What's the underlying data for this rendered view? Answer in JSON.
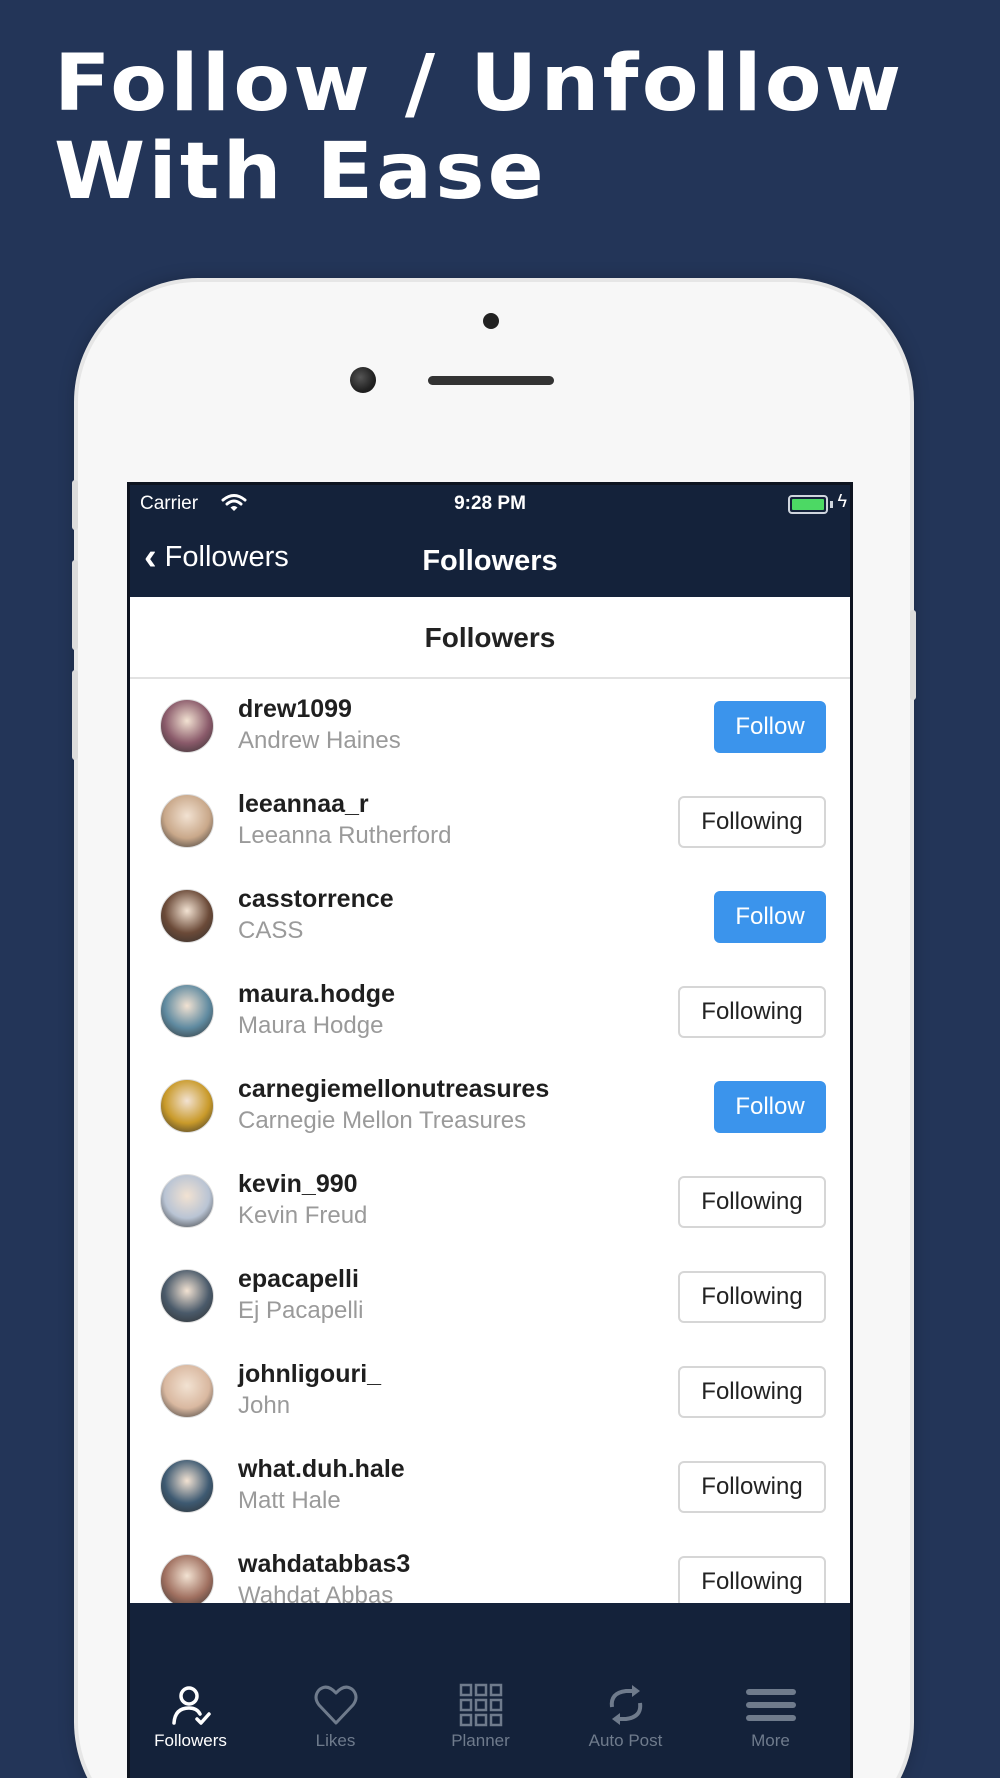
{
  "headline": {
    "line1": "Follow / Unfollow",
    "line2": "With Ease"
  },
  "status_bar": {
    "carrier": "Carrier",
    "time": "9:28 PM"
  },
  "nav": {
    "back_label": "Followers",
    "title": "Followers"
  },
  "section_title": "Followers",
  "followers": [
    {
      "username": "drew1099",
      "name": "Andrew Haines",
      "button": "Follow",
      "state": "follow",
      "avatar_color": "#8a5a6a"
    },
    {
      "username": "leeannaa_r",
      "name": "Leeanna Rutherford",
      "button": "Following",
      "state": "following",
      "avatar_color": "#c9a88a"
    },
    {
      "username": "casstorrence",
      "name": "CASS",
      "button": "Follow",
      "state": "follow",
      "avatar_color": "#6b4a38"
    },
    {
      "username": "maura.hodge",
      "name": "Maura Hodge",
      "button": "Following",
      "state": "following",
      "avatar_color": "#5f8aa0"
    },
    {
      "username": "carnegiemellonutreasures",
      "name": "Carnegie Mellon Treasures",
      "button": "Follow",
      "state": "follow",
      "avatar_color": "#c99a2a"
    },
    {
      "username": "kevin_990",
      "name": "Kevin Freud",
      "button": "Following",
      "state": "following",
      "avatar_color": "#b9c4d4"
    },
    {
      "username": "epacapelli",
      "name": "Ej Pacapelli",
      "button": "Following",
      "state": "following",
      "avatar_color": "#4a5a6a"
    },
    {
      "username": "johnligouri_",
      "name": "John",
      "button": "Following",
      "state": "following",
      "avatar_color": "#d9b8a0"
    },
    {
      "username": "what.duh.hale",
      "name": "Matt Hale",
      "button": "Following",
      "state": "following",
      "avatar_color": "#3e5a72"
    },
    {
      "username": "wahdatabbas3",
      "name": "Wahdat Abbas",
      "button": "Following",
      "state": "following",
      "avatar_color": "#a07060"
    }
  ],
  "tabs": [
    {
      "label": "Followers",
      "icon": "person-check-icon",
      "active": true
    },
    {
      "label": "Likes",
      "icon": "heart-icon",
      "active": false
    },
    {
      "label": "Planner",
      "icon": "grid-icon",
      "active": false
    },
    {
      "label": "Auto Post",
      "icon": "repeat-icon",
      "active": false
    },
    {
      "label": "More",
      "icon": "menu-icon",
      "active": false
    }
  ],
  "colors": {
    "background": "#233558",
    "nav_bar": "#14223a",
    "follow_button": "#3b94ec",
    "battery": "#4cd964"
  }
}
